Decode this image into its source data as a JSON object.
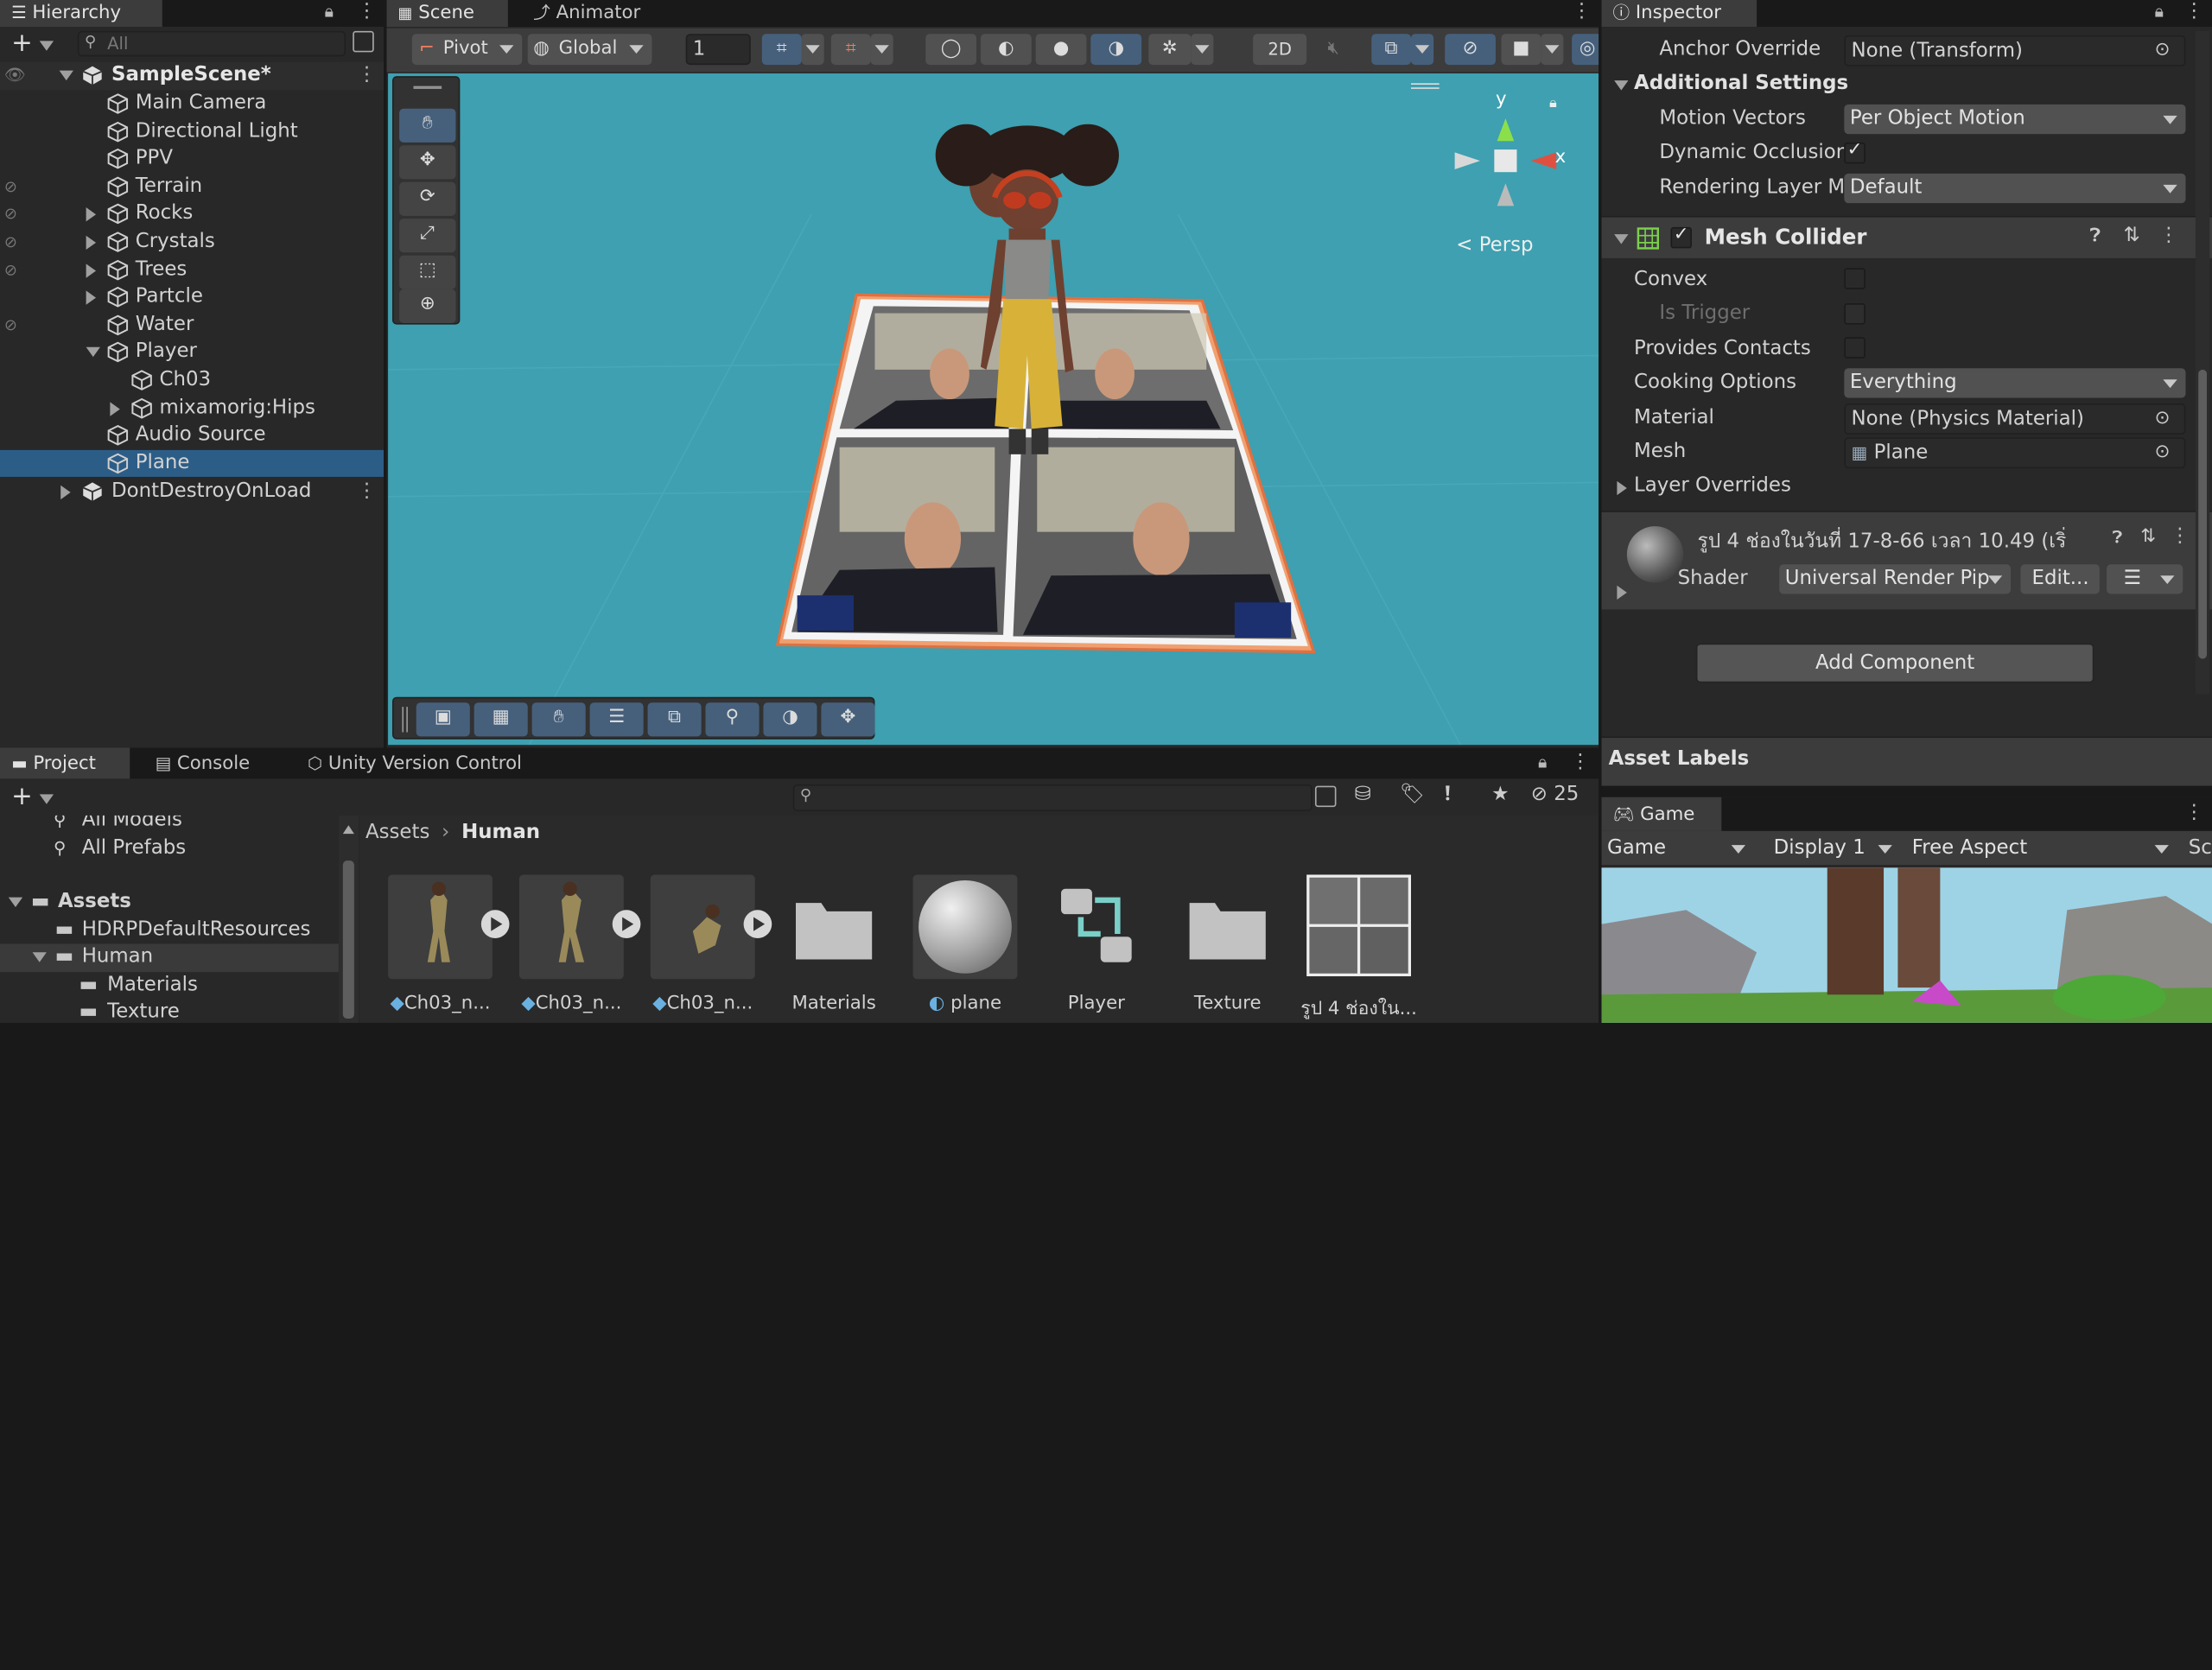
{
  "hierarchy": {
    "tab": "Hierarchy",
    "search_placeholder": "All",
    "scene": "SampleScene*",
    "items": [
      {
        "label": "Main Camera"
      },
      {
        "label": "Directional Light"
      },
      {
        "label": "PPV"
      },
      {
        "label": "Terrain"
      },
      {
        "label": "Rocks"
      },
      {
        "label": "Crystals"
      },
      {
        "label": "Trees"
      },
      {
        "label": "Partcle"
      },
      {
        "label": "Water"
      },
      {
        "label": "Player"
      },
      {
        "label": "Ch03"
      },
      {
        "label": "mixamorig:Hips"
      },
      {
        "label": "Audio Source"
      },
      {
        "label": "Plane"
      }
    ],
    "dontdestroy": "DontDestroyOnLoad"
  },
  "scene": {
    "tab": "Scene",
    "animator_tab": "Animator",
    "pivot": "Pivot",
    "global": "Global",
    "grid_value": "1",
    "mode_2d": "2D",
    "persp": "Persp",
    "gizmo_y": "y",
    "gizmo_x": "x",
    "bg_color": "#3ea0b0"
  },
  "inspector": {
    "tab": "Inspector",
    "anchor_override_label": "Anchor Override",
    "anchor_override_value": "None (Transform)",
    "additional_settings": "Additional Settings",
    "motion_vectors_label": "Motion Vectors",
    "motion_vectors_value": "Per Object Motion",
    "dynamic_occlusion_label": "Dynamic Occlusior",
    "rendering_layer_label": "Rendering Layer M",
    "rendering_layer_value": "Default",
    "mesh_collider": "Mesh Collider",
    "convex": "Convex",
    "is_trigger": "Is Trigger",
    "provides_contacts": "Provides Contacts",
    "cooking_options_label": "Cooking Options",
    "cooking_options_value": "Everything",
    "material_label": "Material",
    "material_value": "None (Physics Material)",
    "mesh_label": "Mesh",
    "mesh_value": "Plane",
    "layer_overrides": "Layer Overrides",
    "material_asset_name": "รูป 4 ช่องในวันที่ 17-8-66 เวลา 10.49 (เริ่",
    "shader_label": "Shader",
    "shader_value": "Universal Render Pip",
    "edit_button": "Edit...",
    "add_component": "Add Component",
    "asset_labels": "Asset Labels"
  },
  "game": {
    "tab": "Game",
    "mode": "Game",
    "display": "Display 1",
    "aspect": "Free Aspect",
    "cut": "Sc"
  },
  "project": {
    "tabs": [
      "Project",
      "Console",
      "Unity Version Control"
    ],
    "hidden_count": "25",
    "tree": {
      "all_models": "All Models",
      "all_prefabs": "All Prefabs",
      "assets": "Assets",
      "hdrp": "HDRPDefaultResources",
      "human": "Human",
      "materials": "Materials",
      "texture": "Texture"
    },
    "breadcrumb": [
      "Assets",
      "Human"
    ],
    "assets": [
      {
        "label": "Ch03_n..."
      },
      {
        "label": "Ch03_n..."
      },
      {
        "label": "Ch03_n..."
      },
      {
        "label": "Materials"
      },
      {
        "label": "plane"
      },
      {
        "label": "Player"
      },
      {
        "label": "Texture"
      },
      {
        "label": "รูป 4 ช่องใน..."
      }
    ]
  }
}
